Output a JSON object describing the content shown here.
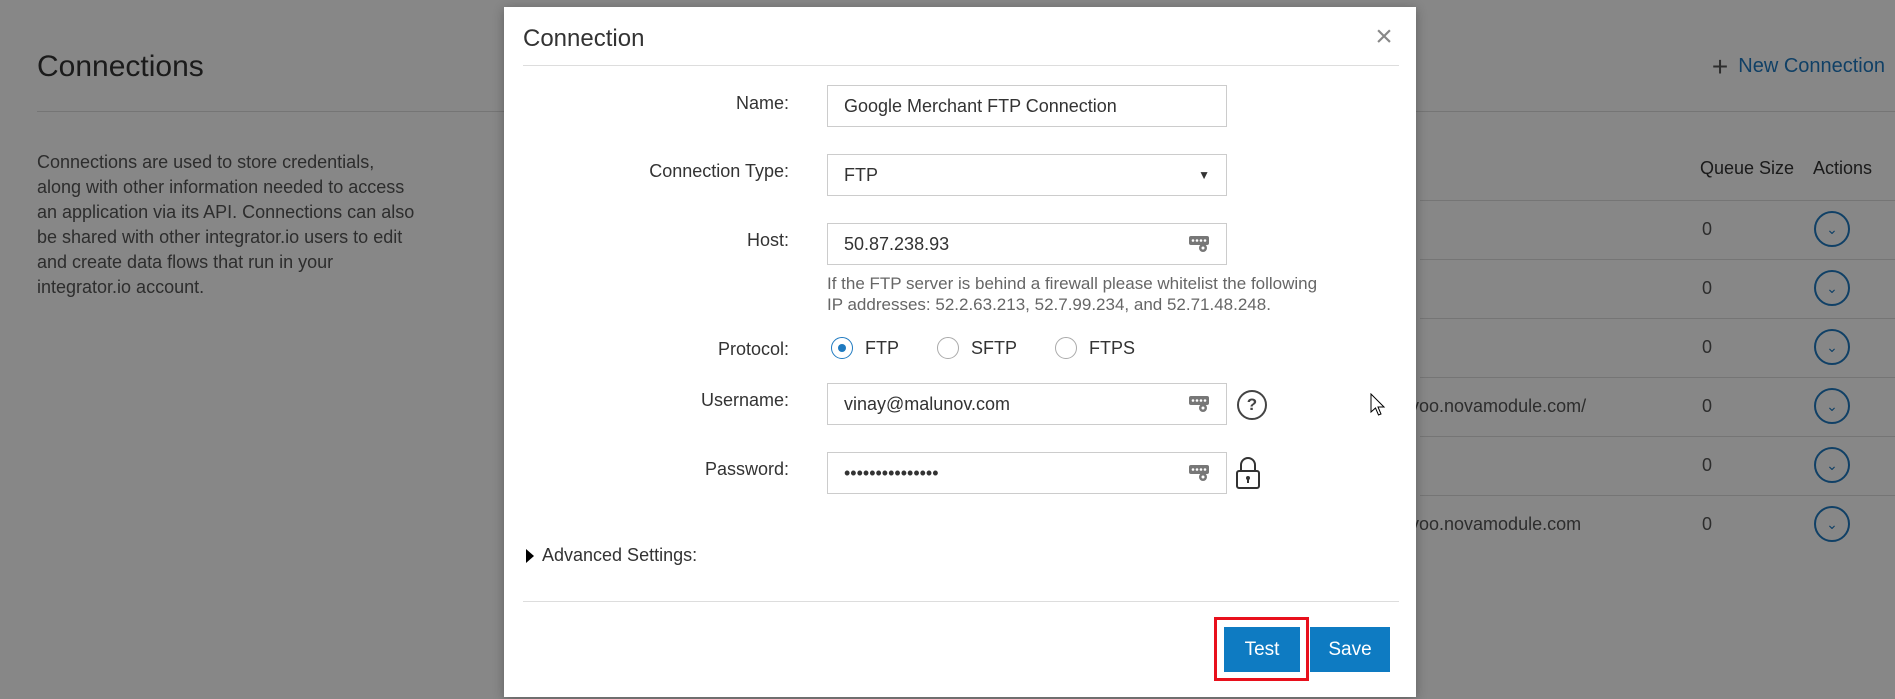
{
  "page": {
    "title": "Connections",
    "new_connection_label": "New Connection",
    "description": "Connections are used to store credentials, along with other information needed to access an application via its API. Connections can also be shared with other integrator.io users to edit and create data flows that run in your integrator.io account.",
    "columns": {
      "queue_size": "Queue Size",
      "actions": "Actions"
    },
    "rows": [
      {
        "url": "",
        "queue": "0"
      },
      {
        "url": "",
        "queue": "0"
      },
      {
        "url": "",
        "queue": "0"
      },
      {
        "url": "voo.novamodule.com/",
        "queue": "0"
      },
      {
        "url": "",
        "queue": "0"
      },
      {
        "url": "voo.novamodule.com",
        "queue": "0"
      }
    ]
  },
  "modal": {
    "title": "Connection",
    "fields": {
      "name": {
        "label": "Name:",
        "value": "Google Merchant FTP Connection"
      },
      "connection_type": {
        "label": "Connection Type:",
        "value": "FTP"
      },
      "host": {
        "label": "Host:",
        "value": "50.87.238.93"
      },
      "host_hint": "If the FTP server is behind a firewall please whitelist the following IP addresses: 52.2.63.213, 52.7.99.234, and 52.71.48.248.",
      "protocol": {
        "label": "Protocol:",
        "options": [
          "FTP",
          "SFTP",
          "FTPS"
        ],
        "selected": "FTP"
      },
      "username": {
        "label": "Username:",
        "value": "vinay@malunov.com"
      },
      "password": {
        "label": "Password:",
        "value": "•••••••••••••••"
      }
    },
    "advanced_label": "Advanced Settings:",
    "buttons": {
      "test": "Test",
      "save": "Save"
    }
  },
  "colors": {
    "accent": "#0e7bc2",
    "highlight": "#e8101c"
  }
}
